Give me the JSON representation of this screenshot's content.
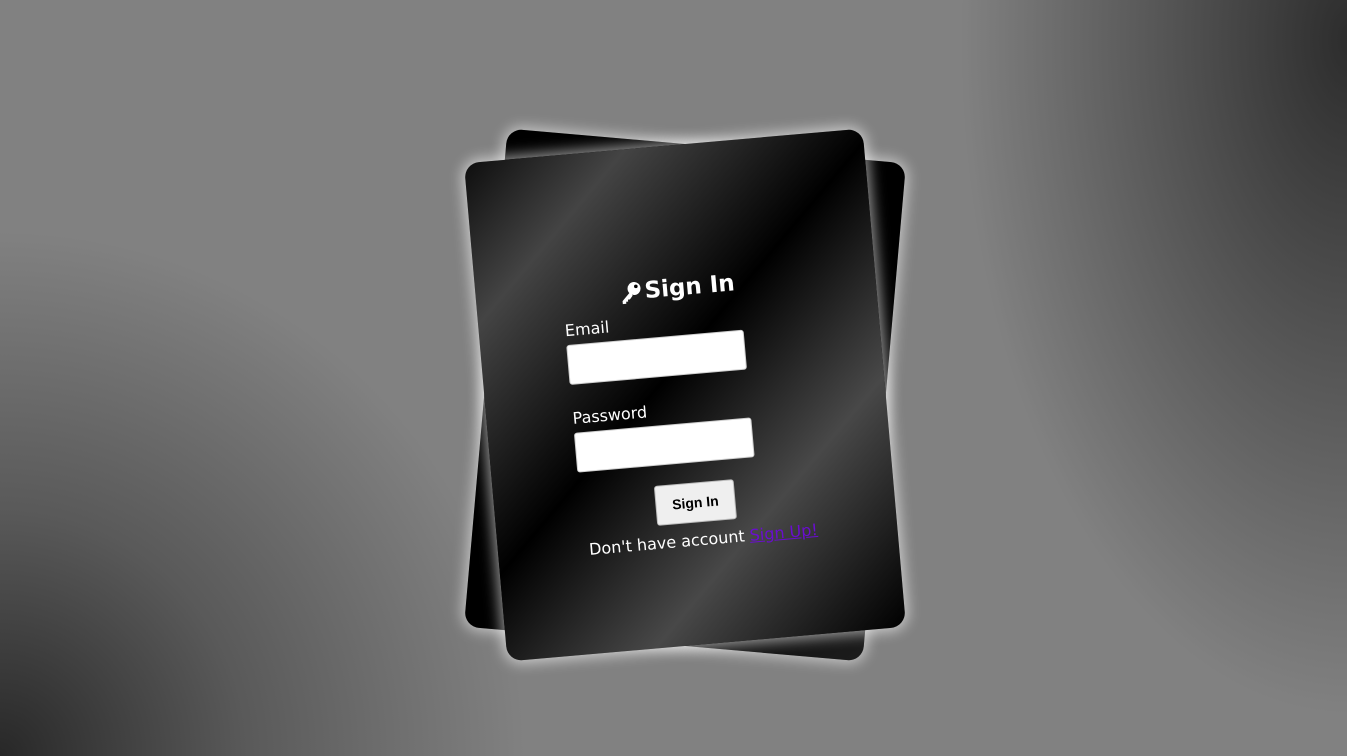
{
  "form": {
    "title": "Sign In",
    "title_icon": "key-icon",
    "email_label": "Email",
    "email_value": "",
    "password_label": "Password",
    "password_value": "",
    "submit_label": "Sign In",
    "signup_prompt": "Don't have account",
    "signup_link": "Sign Up!"
  },
  "colors": {
    "page_background": "#818181",
    "card": "#000000",
    "text": "#ffffff",
    "link": "#6a0dcf",
    "button": "#efefef"
  }
}
